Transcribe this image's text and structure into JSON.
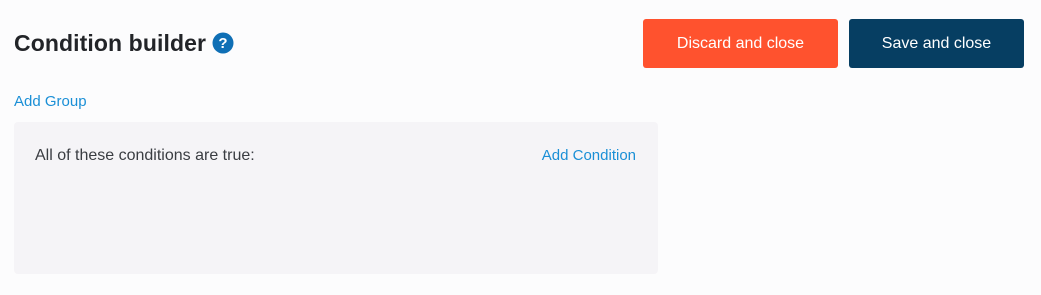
{
  "header": {
    "title": "Condition builder",
    "help_icon": "question-circle-icon"
  },
  "actions": {
    "discard_label": "Discard and close",
    "save_label": "Save and close"
  },
  "links": {
    "add_group": "Add Group"
  },
  "group": {
    "title": "All of these conditions are true:",
    "add_condition": "Add Condition"
  },
  "colors": {
    "discard": "#ff522e",
    "save": "#063e62",
    "link": "#1a8fd6",
    "help_icon": "#0f6fb5",
    "panel_bg": "#f5f4f7"
  }
}
